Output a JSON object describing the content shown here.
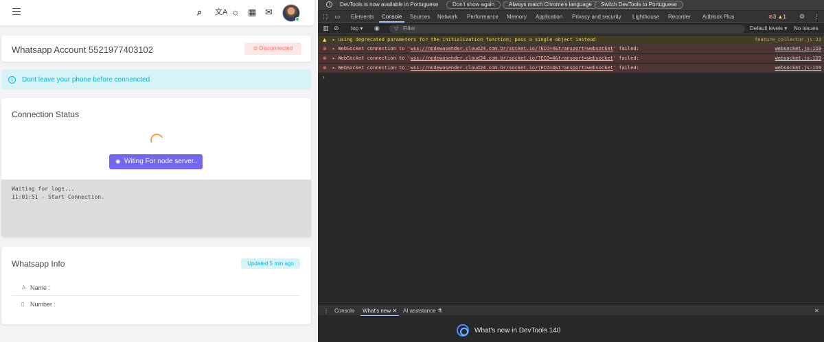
{
  "app": {
    "topbar": {
      "menu_icon": "menu-icon",
      "icons": [
        "search-icon",
        "translate-icon",
        "theme-sun-icon",
        "grid-shortcuts-icon",
        "notification-icon"
      ]
    },
    "account": {
      "title": "Whatsapp Account 5521977403102",
      "status_badge": "Disconnected",
      "status_color": "#ff6b6b"
    },
    "alert": {
      "text": "Dont leave your phone before connencted",
      "color": "#00bad1"
    },
    "connection": {
      "title": "Connection Status",
      "button_label": "Witing For node server..",
      "button_color": "#7367f0",
      "logs": [
        "Waiting for logs...",
        "11:01:51 - Start Connection."
      ]
    },
    "info": {
      "title": "Whatsapp Info",
      "updated_badge": "Updated 5 min ago",
      "rows": [
        {
          "icon": "user-icon",
          "label": "Name :"
        },
        {
          "icon": "phone-icon",
          "label": "Number :"
        }
      ]
    }
  },
  "devtools": {
    "infobar": {
      "message": "DevTools is now available in Portuguese",
      "buttons": [
        "Don't show again",
        "Always match Chrome's language",
        "Switch DevTools to Portuguese"
      ]
    },
    "tabs": [
      "Elements",
      "Console",
      "Sources",
      "Network",
      "Performance",
      "Memory",
      "Application",
      "Privacy and security",
      "Lighthouse",
      "Recorder",
      "Adblock Plus"
    ],
    "active_tab": "Console",
    "error_count": "3",
    "warning_count": "1",
    "toolbar": {
      "context": "top ▾",
      "filter_placeholder": "Filter",
      "levels": "Default levels ▾",
      "issues": "No Issues"
    },
    "messages": [
      {
        "level": "warning",
        "text": "using deprecated parameters for the initialization function; pass a single object instead",
        "source": "feature_collector.js:23"
      },
      {
        "level": "error",
        "prefix": "WebSocket connection to '",
        "url": "wss://nodewasender.cloud24.com.br/socket.io/?EIO=4&transport=websocket",
        "suffix": "' failed:",
        "source": "websocket.js:119"
      },
      {
        "level": "error",
        "prefix": "WebSocket connection to '",
        "url": "wss://nodewasender.cloud24.com.br/socket.io/?EIO=4&transport=websocket",
        "suffix": "' failed:",
        "source": "websocket.js:119"
      },
      {
        "level": "error",
        "prefix": "WebSocket connection to '",
        "url": "wss://nodewasender.cloud24.com.br/socket.io/?EIO=4&transport=websocket",
        "suffix": "' failed:",
        "source": "websocket.js:119"
      }
    ],
    "drawer": {
      "tabs": [
        "Console",
        "What's new",
        "AI assistance"
      ],
      "active": "What's new"
    },
    "whats_new": "What's new in DevTools 140"
  }
}
